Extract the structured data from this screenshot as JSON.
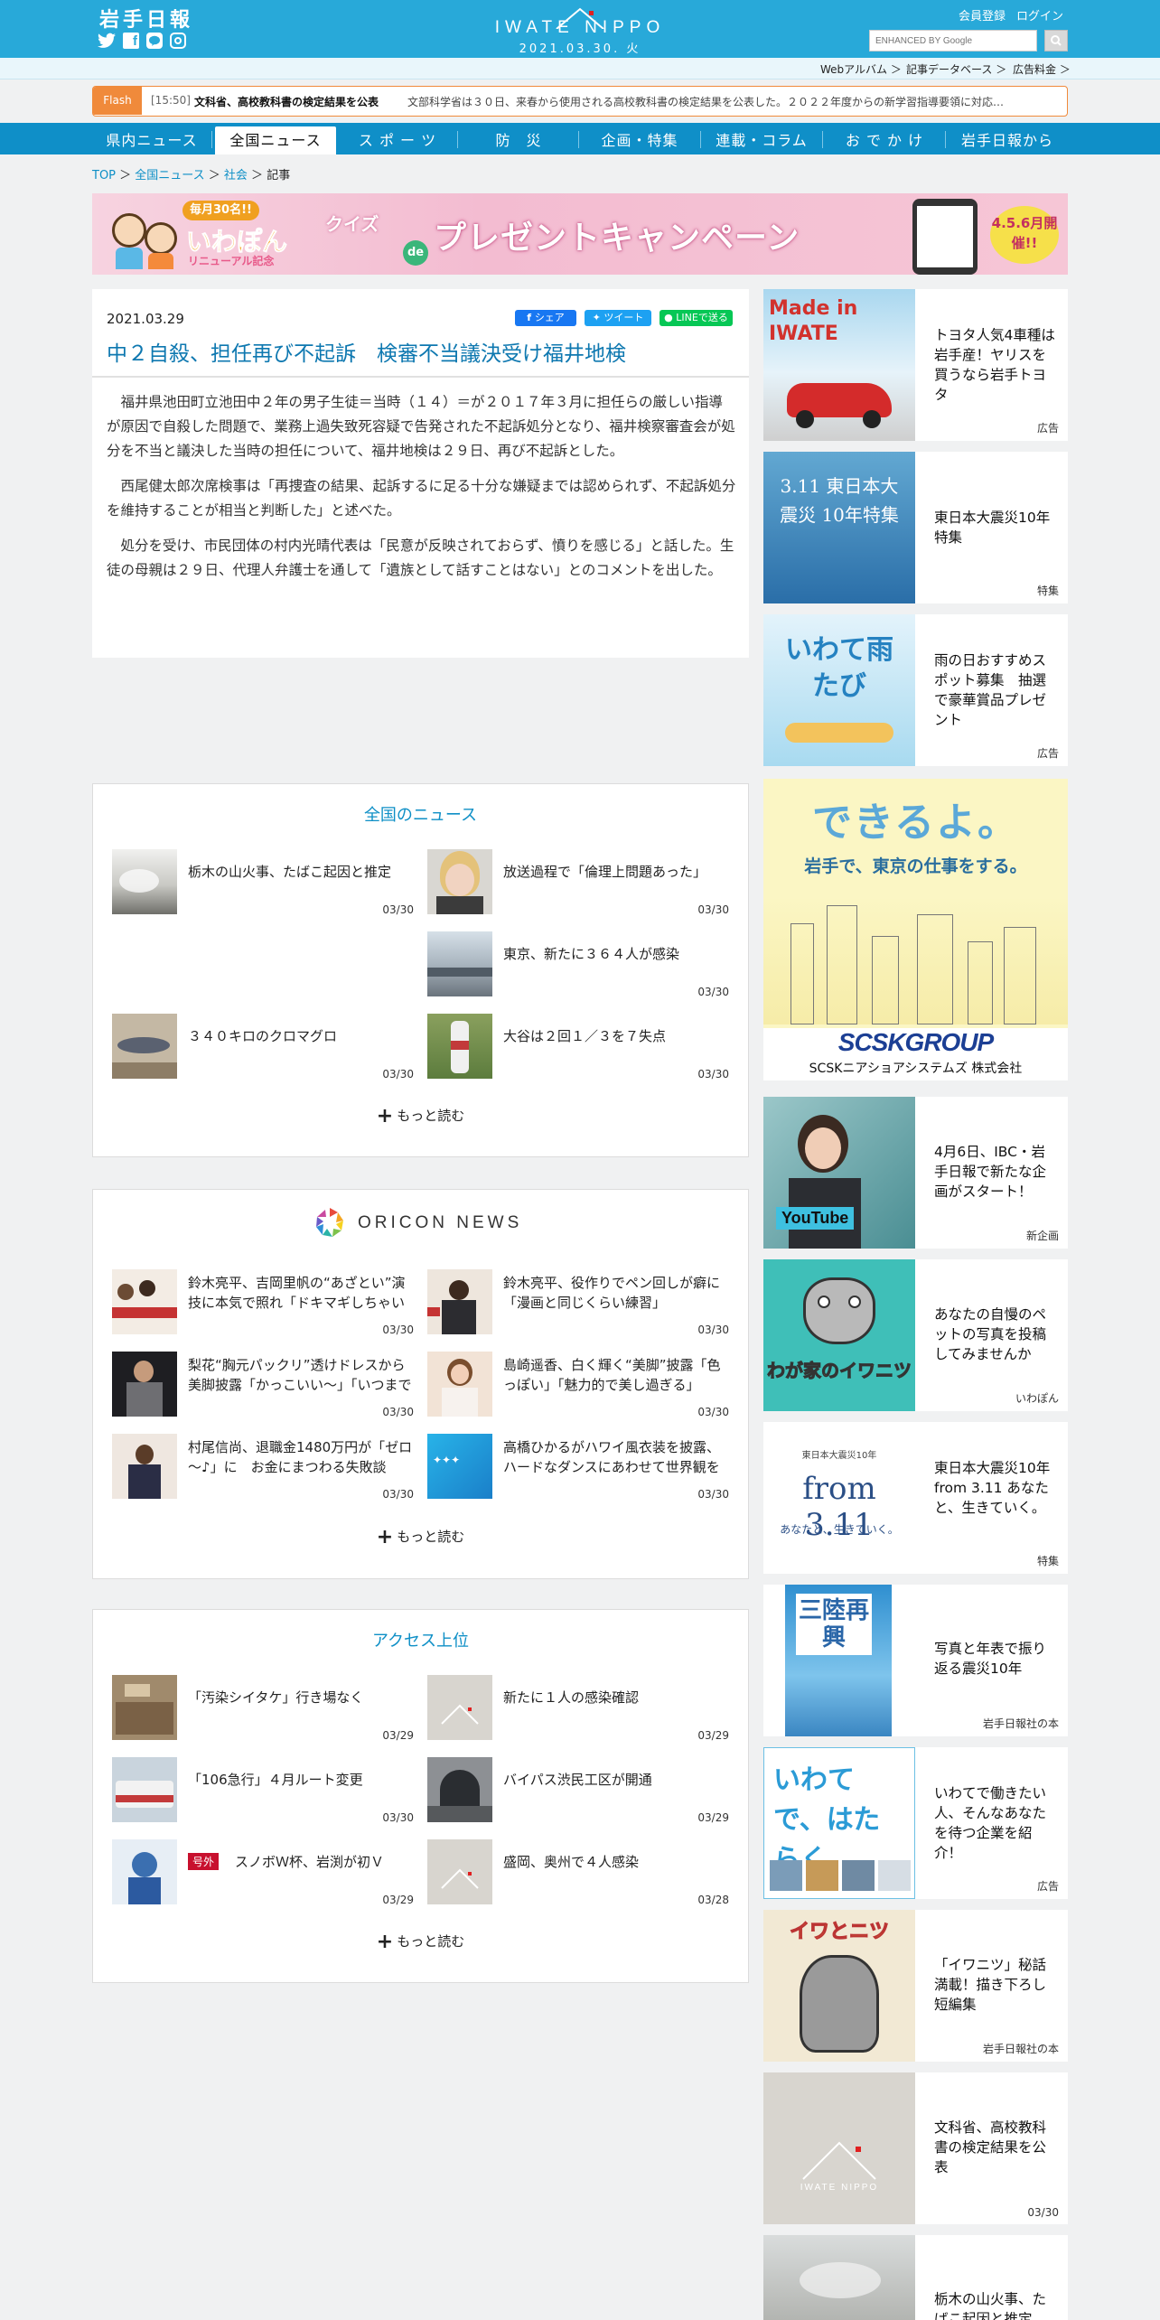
{
  "header": {
    "logo": "岩手日報",
    "brand": "IWATE NIPPO",
    "date": "2021.03.30. 火",
    "register": "会員登録",
    "login": "ログイン",
    "search_placeholder": "ENHANCED BY Google",
    "social": [
      "twitter-icon",
      "facebook-icon",
      "line-icon",
      "instagram-icon"
    ]
  },
  "subnav": [
    "Webアルバム ＞",
    "記事データベース ＞",
    "広告料金 ＞"
  ],
  "flash": {
    "label": "Flash",
    "time": "[15:50]",
    "headline": "文科省、高校教科書の検定結果を公表",
    "summary": "文部科学省は３０日、来春から使用される高校教科書の検定結果を公表した。２０２２年度からの新学習指導要領に対応…"
  },
  "nav": [
    "県内ニュース",
    "全国ニュース",
    "ス ポ ー ツ",
    "防　災",
    "企画・特集",
    "連載・コラム",
    "お で か け",
    "岩手日報から"
  ],
  "breadcrumb": [
    "TOP",
    "全国ニュース",
    "社会",
    "記事"
  ],
  "banner": {
    "badge": "毎月30名!!",
    "brand": "いわぽん",
    "sub": "リニューアル記念",
    "quiz": "クイズ",
    "de": "de",
    "main": "プレゼントキャンペーン",
    "dates": "4.5.6月開催!!"
  },
  "article": {
    "date": "2021.03.29",
    "share": [
      "シェア",
      "ツイート",
      "LINEで送る"
    ],
    "title": "中２自殺、担任再び不起訴　検審不当議決受け福井地検",
    "paragraphs": [
      "福井県池田町立池田中２年の男子生徒＝当時（１４）＝が２０１７年３月に担任らの厳しい指導が原因で自殺した問題で、業務上過失致死容疑で告発された不起訴処分となり、福井検察審査会が処分を不当と議決した当時の担任について、福井地検は２９日、再び不起訴とした。",
      "西尾健太郎次席検事は「再捜査の結果、起訴するに足る十分な嫌疑までは認められず、不起訴処分を維持することが相当と判断した」と述べた。",
      "処分を受け、市民団体の村内光晴代表は「民意が反映されておらず、憤りを感じる」と話した。生徒の母親は２９日、代理人弁護士を通して「遺族として話すことはない」とのコメントを出した。"
    ]
  },
  "national": {
    "title": "全国のニュース",
    "items": [
      {
        "title": "栃木の山火事、たばこ起因と推定",
        "date": "03/30"
      },
      {
        "title": "放送過程で「倫理上問題あった」",
        "date": "03/30"
      },
      {
        "title": "東京、新たに３６４人が感染",
        "date": "03/30"
      },
      {
        "title": "３４０キロのクロマグロ",
        "date": "03/30"
      },
      {
        "title": "大谷は２回１／３を７失点",
        "date": "03/30"
      }
    ],
    "more": "もっと読む"
  },
  "oricon": {
    "title": "ORICON NEWS",
    "items": [
      {
        "title": "鈴木亮平、吉岡里帆の“あざとい”演技に本気で照れ「ドキマギしちゃいました」",
        "date": "03/30"
      },
      {
        "title": "鈴木亮平、役作りでペン回しが癖に「漫画と同じくらい練習」",
        "date": "03/30"
      },
      {
        "title": "梨花“胸元パックリ”透けドレスから美脚披露「かっこいい〜」「いつまでも素敵」",
        "date": "03/30"
      },
      {
        "title": "島崎遥香、白く輝く“美脚”披露「色っぽい」「魅力的で美し過ぎる」",
        "date": "03/30"
      },
      {
        "title": "村尾信尚、退職金1480万円が「ゼロ～♪」に　お金にまつわる失敗談",
        "date": "03/30"
      },
      {
        "title": "高橋ひかるがハワイ風衣装を披露、ハードなダンスにあわせて世界観を表現",
        "date": "03/30"
      }
    ],
    "more": "もっと読む"
  },
  "access": {
    "title": "アクセス上位",
    "items": [
      {
        "title": "「汚染シイタケ」行き場なく",
        "date": "03/29"
      },
      {
        "title": "新たに１人の感染確認",
        "date": "03/29"
      },
      {
        "title": "「106急行」４月ルート変更",
        "date": "03/30"
      },
      {
        "title": "バイパス渋民工区が開通",
        "date": "03/29"
      },
      {
        "title": "スノボＷ杯、岩渕が初Ｖ",
        "badge": "号外",
        "date": "03/29"
      },
      {
        "title": "盛岡、奥州で４人感染",
        "date": "03/28"
      }
    ],
    "more": "もっと読む"
  },
  "sidebar": [
    {
      "title": "トヨタ人気4車種は岩手産！ヤリスを買うなら岩手トヨタ",
      "tag": "広告",
      "thumb": "Made in IWATE"
    },
    {
      "title": "東日本大震災10年特集",
      "tag": "特集",
      "thumb": "3.11 東日本大震災 10年特集"
    },
    {
      "title": "雨の日おすすめスポット募集　抽選で豪華賞品プレゼント",
      "tag": "広告",
      "thumb": "いわて雨たび"
    },
    {
      "thumb_title": "できるよ。",
      "thumb_sub": "岩手で、東京の仕事をする。",
      "logo": "SCSKGROUP",
      "company": "SCSKニアショアシステムズ 株式会社"
    },
    {
      "title": "4月6日、IBC・岩手日報で新たな企画がスタート！",
      "tag": "新企画",
      "thumb": "YouTube"
    },
    {
      "title": "あなたの自慢のペットの写真を投稿してみませんか",
      "tag": "いわぽん",
      "thumb": "わが家のイワニツ"
    },
    {
      "title": "東日本大震災10年 from 3.11 あなたと、生きていく。",
      "tag": "特集",
      "thumb": "from 3.11",
      "thumb_top": "東日本大震災10年",
      "thumb_sub": "あなたと、生きていく。"
    },
    {
      "title": "写真と年表で振り返る震災10年",
      "tag": "岩手日報社の本",
      "thumb": "三陸再興"
    },
    {
      "title": "いわてで働きたい人、そんなあなたを待つ企業を紹介！",
      "tag": "広告",
      "thumb": "いわてで、はたらく"
    },
    {
      "title": "「イワニツ」秘話満載！描き下ろし短編集",
      "tag": "岩手日報社の本",
      "thumb": "イワとニツ"
    },
    {
      "title": "文科省、高校教科書の検定結果を公表",
      "tag": "03/30",
      "thumb": "IWATE NIPPO"
    },
    {
      "title": "栃木の山火事、たばこ起因と推定"
    }
  ],
  "colors": {
    "brand": "#28a9d9",
    "nav": "#0f8fc8",
    "accent": "#0e8fc6",
    "flash": "#f08a3b",
    "badge": "#c8102e"
  }
}
